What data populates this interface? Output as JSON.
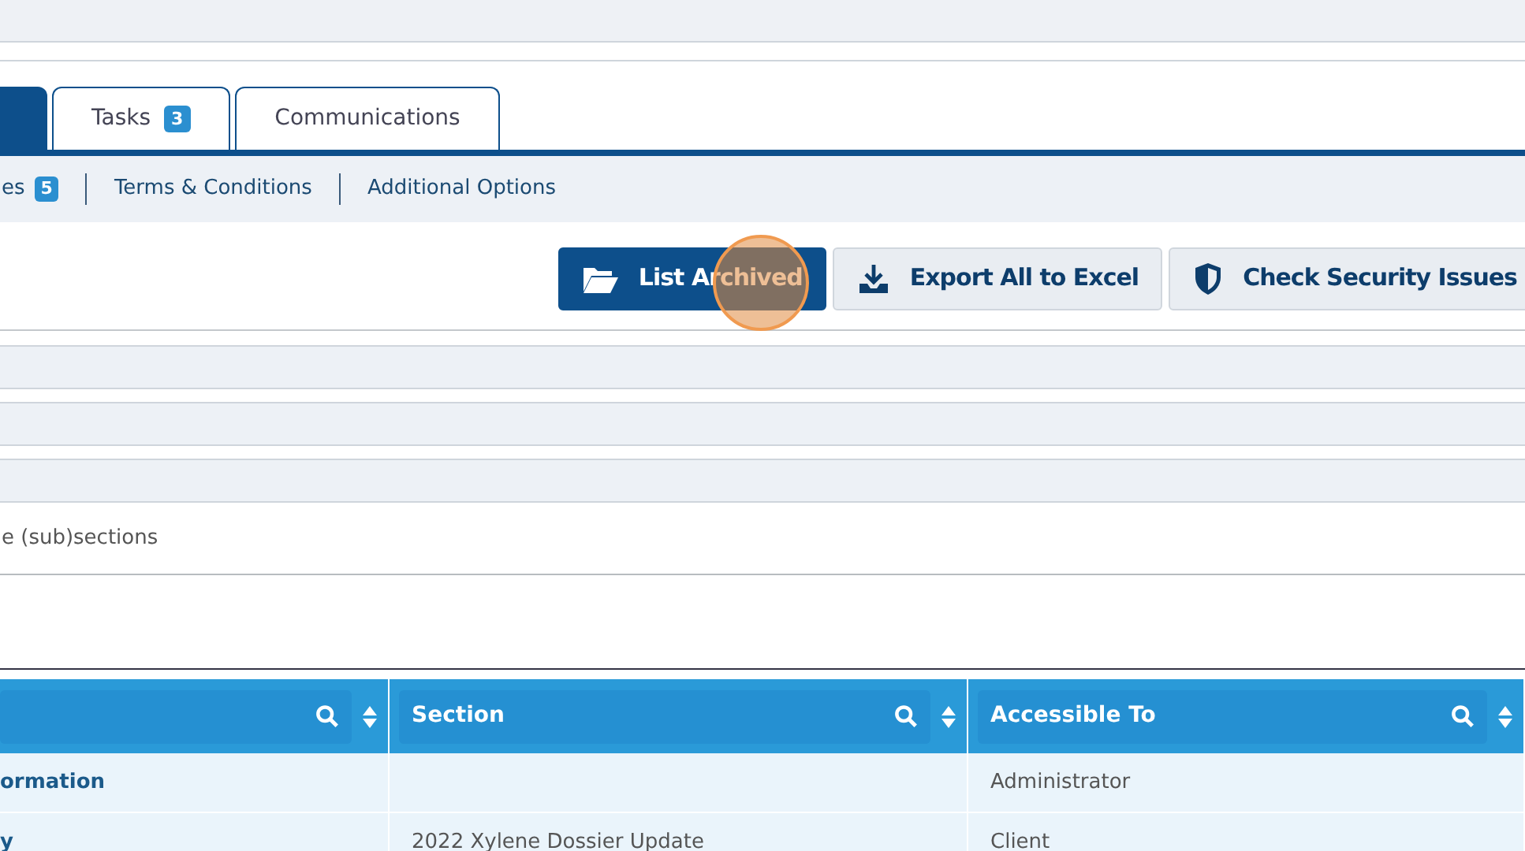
{
  "tabs": [
    {
      "selected": true
    },
    {
      "label": "Tasks",
      "badge": "3",
      "selected": false
    },
    {
      "label": "Communications",
      "selected": false
    }
  ],
  "subnav": [
    {
      "label": "es",
      "badge": "5"
    },
    {
      "label": "Terms & Conditions"
    },
    {
      "label": "Additional Options"
    }
  ],
  "toolbar": [
    {
      "label": "List Archived",
      "kind": "primary"
    },
    {
      "label": "Export All to Excel",
      "kind": "secondary"
    },
    {
      "label": "Check Security Issues",
      "kind": "secondary"
    }
  ],
  "note": "e (sub)sections",
  "table": {
    "columns": [
      "",
      "Section",
      "Accessible To"
    ],
    "rows": [
      {
        "cells": [
          "ormation",
          "",
          "Administrator"
        ]
      },
      {
        "cells": [
          "y",
          "2022 Xylene Dossier Update",
          "Client"
        ]
      }
    ]
  }
}
